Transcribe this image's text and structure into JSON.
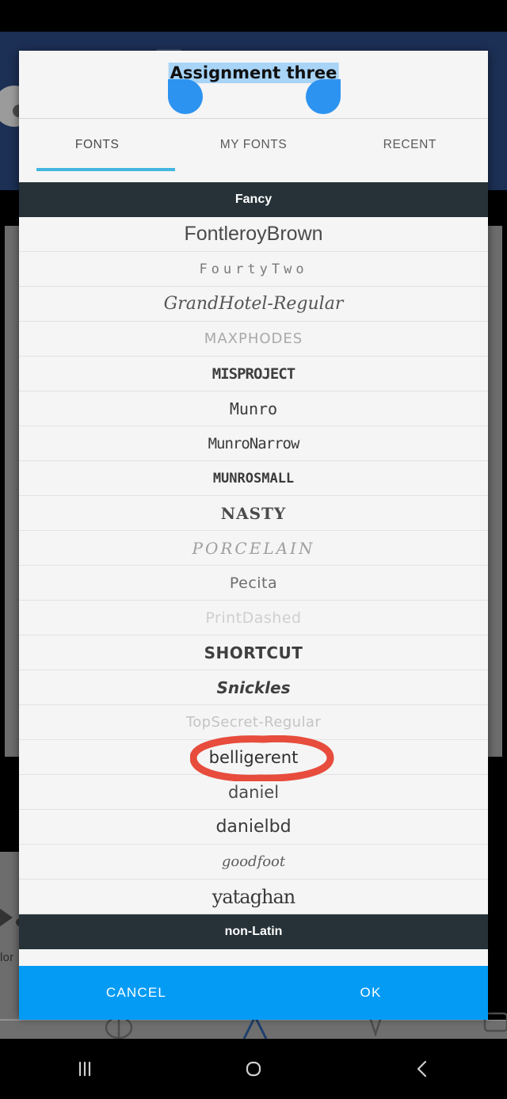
{
  "background_app": {
    "tool_label": "lor",
    "ink_icon": "ink-droplet-icon"
  },
  "dialog": {
    "preview": {
      "text": "Assignment three",
      "selection_handle_left": "selection-handle-left",
      "selection_handle_right": "selection-handle-right"
    },
    "tabs": [
      {
        "label": "FONTS",
        "active": true
      },
      {
        "label": "MY FONTS",
        "active": false
      },
      {
        "label": "RECENT",
        "active": false
      }
    ],
    "sections": [
      {
        "title": "Fancy"
      },
      {
        "title": "non-Latin"
      }
    ],
    "fonts": [
      {
        "name": "FontleroyBrown",
        "style": "f-fontleroy"
      },
      {
        "name": "FourtyTwo",
        "style": "f-fourtytwo"
      },
      {
        "name": "GrandHotel-Regular",
        "style": "f-grandhotel"
      },
      {
        "name": "MAXPHODES",
        "style": "f-maxphodes"
      },
      {
        "name": "MISPROJECT",
        "style": "f-misproject"
      },
      {
        "name": "Munro",
        "style": "f-munro"
      },
      {
        "name": "MunroNarrow",
        "style": "f-munronarrow"
      },
      {
        "name": "MUNROSMALL",
        "style": "f-munrosmall"
      },
      {
        "name": "NASTY",
        "style": "f-nasty"
      },
      {
        "name": "PORCELAIN",
        "style": "f-porcelain"
      },
      {
        "name": "Pecita",
        "style": "f-pecita"
      },
      {
        "name": "PrintDashed",
        "style": "f-printdashed"
      },
      {
        "name": "SHORTCUT",
        "style": "f-shortcut"
      },
      {
        "name": "Snickles",
        "style": "f-snickles"
      },
      {
        "name": "TopSecret-Regular",
        "style": "f-topsecret"
      },
      {
        "name": "belligerent",
        "style": "f-belligerent",
        "annotated": true
      },
      {
        "name": "daniel",
        "style": "f-daniel"
      },
      {
        "name": "danielbd",
        "style": "f-danielbd"
      },
      {
        "name": "goodfoot",
        "style": "f-goodfoot"
      },
      {
        "name": "yataghan",
        "style": "f-yataghan"
      }
    ],
    "actions": {
      "cancel_label": "CANCEL",
      "ok_label": "OK"
    }
  },
  "annotation": {
    "target": "belligerent",
    "shape": "red-ellipse-circle",
    "color": "#e74c3c"
  },
  "nav_bar": {
    "recents": "recents-icon",
    "home": "home-icon",
    "back": "back-icon"
  },
  "colors": {
    "accent_blue": "#039bf4",
    "tab_indicator": "#41b6e0",
    "section_header_bg": "#263238",
    "selection_highlight": "#a8d4f7",
    "handle_blue": "#2d93f0",
    "app_navy": "#1c2f54",
    "annotation_red": "#e74c3c"
  }
}
